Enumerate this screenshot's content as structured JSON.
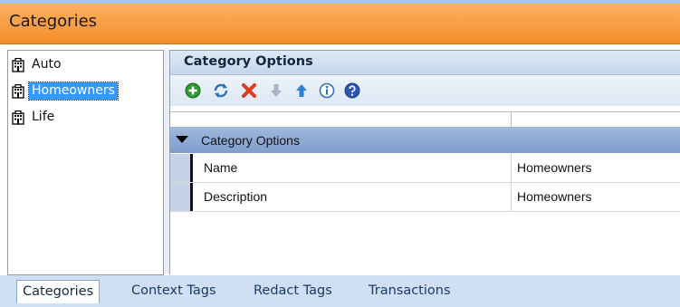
{
  "window": {
    "title": "Categories"
  },
  "tree": {
    "items": [
      {
        "label": "Auto",
        "selected": false,
        "icon": "building-icon"
      },
      {
        "label": "Homeowners",
        "selected": true,
        "icon": "building-icon"
      },
      {
        "label": "Life",
        "selected": false,
        "icon": "building-icon"
      }
    ]
  },
  "options": {
    "title": "Category Options",
    "toolbar": [
      "add-icon",
      "refresh-icon",
      "delete-icon",
      "move-down-icon",
      "move-up-icon",
      "info-icon",
      "help-icon"
    ],
    "group_label": "Category Options",
    "rows": [
      {
        "name": "Name",
        "value": "Homeowners"
      },
      {
        "name": "Description",
        "value": "Homeowners"
      }
    ]
  },
  "tabs": [
    {
      "label": "Categories",
      "active": true
    },
    {
      "label": "Context Tags",
      "active": false
    },
    {
      "label": "Redact Tags",
      "active": false
    },
    {
      "label": "Transactions",
      "active": false
    }
  ],
  "colors": {
    "header": "#f5962f",
    "selection": "#3399ff",
    "group_row": "#8fabd6",
    "tabstrip": "#cfe0f5"
  }
}
